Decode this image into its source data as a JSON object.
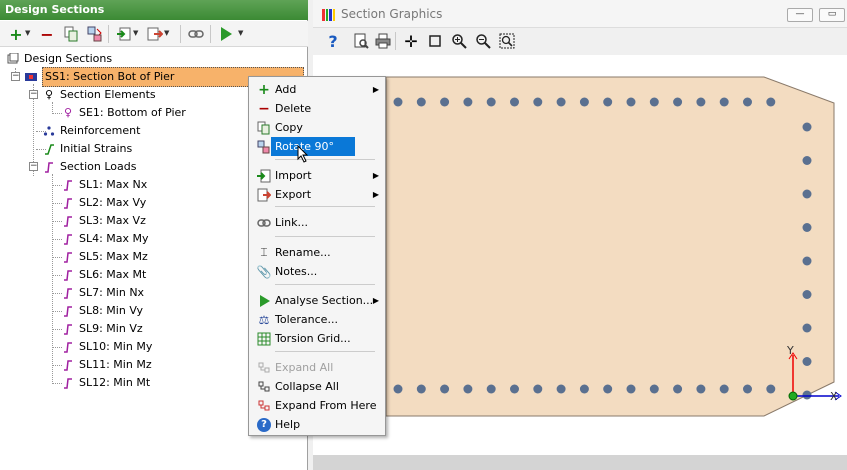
{
  "left_panel": {
    "title": "Design Sections",
    "tree": {
      "root": "Design Sections",
      "selected": "SS1: Section Bot of Pier",
      "section_elements": "Section Elements",
      "element_1": "SE1: Bottom of Pier",
      "reinforcement": "Reinforcement",
      "initial_strains": "Initial Strains",
      "section_loads": "Section Loads",
      "loads": [
        "SL1: Max Nx",
        "SL2: Max Vy",
        "SL3: Max Vz",
        "SL4: Max My",
        "SL5: Max Mz",
        "SL6: Max Mt",
        "SL7: Min Nx",
        "SL8: Min Vy",
        "SL9: Min Vz",
        "SL10: Min My",
        "SL11: Min Mz",
        "SL12: Min Mt"
      ]
    }
  },
  "right_panel": {
    "title": "Section Graphics",
    "axis_y": "Y",
    "axis_x": "X"
  },
  "context_menu": {
    "items": [
      {
        "label": "Add",
        "icon": "plus-icon",
        "submenu": true
      },
      {
        "label": "Delete",
        "icon": "minus-icon"
      },
      {
        "label": "Copy",
        "icon": "copy-icon"
      },
      {
        "label": "Rotate 90°",
        "icon": "rotate-icon",
        "highlighted": true
      },
      {
        "label": "Import",
        "icon": "import-icon",
        "submenu": true
      },
      {
        "label": "Export",
        "icon": "export-icon",
        "submenu": true
      },
      {
        "label": "Link...",
        "icon": "link-icon"
      },
      {
        "label": "Rename...",
        "icon": "rename-icon"
      },
      {
        "label": "Notes...",
        "icon": "paperclip-icon"
      },
      {
        "label": "Analyse Section...",
        "icon": "play-icon",
        "submenu": true
      },
      {
        "label": "Tolerance...",
        "icon": "balance-icon"
      },
      {
        "label": "Torsion Grid...",
        "icon": "grid-icon"
      },
      {
        "label": "Expand All",
        "icon": "expand-icon",
        "disabled": true
      },
      {
        "label": "Collapse All",
        "icon": "collapse-icon"
      },
      {
        "label": "Expand From Here",
        "icon": "expand-here-icon"
      },
      {
        "label": "Help",
        "icon": "help-icon"
      }
    ]
  },
  "colors": {
    "title_green": "#3b8a34",
    "selection_orange": "#f7b26a",
    "section_fill": "#f3dcc1",
    "rebar": "#5a7090",
    "highlight_blue": "#0a78d7"
  }
}
